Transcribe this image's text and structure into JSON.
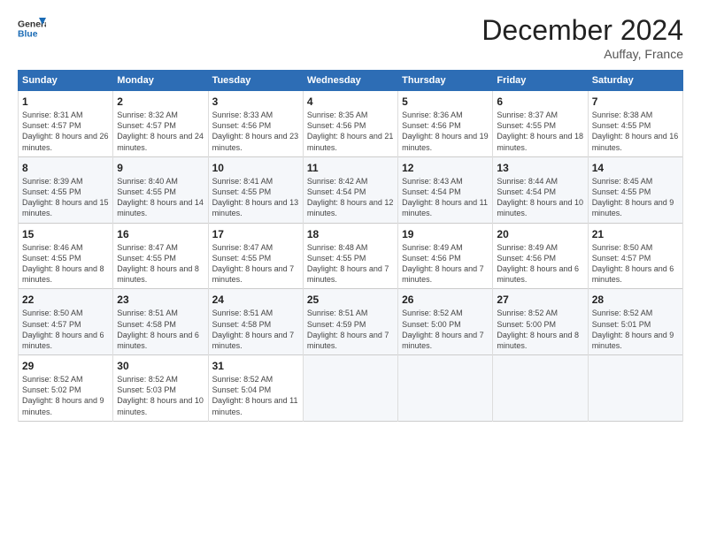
{
  "logo": {
    "line1": "General",
    "line2": "Blue"
  },
  "header": {
    "title": "December 2024",
    "location": "Auffay, France"
  },
  "days_of_week": [
    "Sunday",
    "Monday",
    "Tuesday",
    "Wednesday",
    "Thursday",
    "Friday",
    "Saturday"
  ],
  "weeks": [
    [
      {
        "day": "1",
        "rise": "Sunrise: 8:31 AM",
        "set": "Sunset: 4:57 PM",
        "daylight": "Daylight: 8 hours and 26 minutes."
      },
      {
        "day": "2",
        "rise": "Sunrise: 8:32 AM",
        "set": "Sunset: 4:57 PM",
        "daylight": "Daylight: 8 hours and 24 minutes."
      },
      {
        "day": "3",
        "rise": "Sunrise: 8:33 AM",
        "set": "Sunset: 4:56 PM",
        "daylight": "Daylight: 8 hours and 23 minutes."
      },
      {
        "day": "4",
        "rise": "Sunrise: 8:35 AM",
        "set": "Sunset: 4:56 PM",
        "daylight": "Daylight: 8 hours and 21 minutes."
      },
      {
        "day": "5",
        "rise": "Sunrise: 8:36 AM",
        "set": "Sunset: 4:56 PM",
        "daylight": "Daylight: 8 hours and 19 minutes."
      },
      {
        "day": "6",
        "rise": "Sunrise: 8:37 AM",
        "set": "Sunset: 4:55 PM",
        "daylight": "Daylight: 8 hours and 18 minutes."
      },
      {
        "day": "7",
        "rise": "Sunrise: 8:38 AM",
        "set": "Sunset: 4:55 PM",
        "daylight": "Daylight: 8 hours and 16 minutes."
      }
    ],
    [
      {
        "day": "8",
        "rise": "Sunrise: 8:39 AM",
        "set": "Sunset: 4:55 PM",
        "daylight": "Daylight: 8 hours and 15 minutes."
      },
      {
        "day": "9",
        "rise": "Sunrise: 8:40 AM",
        "set": "Sunset: 4:55 PM",
        "daylight": "Daylight: 8 hours and 14 minutes."
      },
      {
        "day": "10",
        "rise": "Sunrise: 8:41 AM",
        "set": "Sunset: 4:55 PM",
        "daylight": "Daylight: 8 hours and 13 minutes."
      },
      {
        "day": "11",
        "rise": "Sunrise: 8:42 AM",
        "set": "Sunset: 4:54 PM",
        "daylight": "Daylight: 8 hours and 12 minutes."
      },
      {
        "day": "12",
        "rise": "Sunrise: 8:43 AM",
        "set": "Sunset: 4:54 PM",
        "daylight": "Daylight: 8 hours and 11 minutes."
      },
      {
        "day": "13",
        "rise": "Sunrise: 8:44 AM",
        "set": "Sunset: 4:54 PM",
        "daylight": "Daylight: 8 hours and 10 minutes."
      },
      {
        "day": "14",
        "rise": "Sunrise: 8:45 AM",
        "set": "Sunset: 4:55 PM",
        "daylight": "Daylight: 8 hours and 9 minutes."
      }
    ],
    [
      {
        "day": "15",
        "rise": "Sunrise: 8:46 AM",
        "set": "Sunset: 4:55 PM",
        "daylight": "Daylight: 8 hours and 8 minutes."
      },
      {
        "day": "16",
        "rise": "Sunrise: 8:47 AM",
        "set": "Sunset: 4:55 PM",
        "daylight": "Daylight: 8 hours and 8 minutes."
      },
      {
        "day": "17",
        "rise": "Sunrise: 8:47 AM",
        "set": "Sunset: 4:55 PM",
        "daylight": "Daylight: 8 hours and 7 minutes."
      },
      {
        "day": "18",
        "rise": "Sunrise: 8:48 AM",
        "set": "Sunset: 4:55 PM",
        "daylight": "Daylight: 8 hours and 7 minutes."
      },
      {
        "day": "19",
        "rise": "Sunrise: 8:49 AM",
        "set": "Sunset: 4:56 PM",
        "daylight": "Daylight: 8 hours and 7 minutes."
      },
      {
        "day": "20",
        "rise": "Sunrise: 8:49 AM",
        "set": "Sunset: 4:56 PM",
        "daylight": "Daylight: 8 hours and 6 minutes."
      },
      {
        "day": "21",
        "rise": "Sunrise: 8:50 AM",
        "set": "Sunset: 4:57 PM",
        "daylight": "Daylight: 8 hours and 6 minutes."
      }
    ],
    [
      {
        "day": "22",
        "rise": "Sunrise: 8:50 AM",
        "set": "Sunset: 4:57 PM",
        "daylight": "Daylight: 8 hours and 6 minutes."
      },
      {
        "day": "23",
        "rise": "Sunrise: 8:51 AM",
        "set": "Sunset: 4:58 PM",
        "daylight": "Daylight: 8 hours and 6 minutes."
      },
      {
        "day": "24",
        "rise": "Sunrise: 8:51 AM",
        "set": "Sunset: 4:58 PM",
        "daylight": "Daylight: 8 hours and 7 minutes."
      },
      {
        "day": "25",
        "rise": "Sunrise: 8:51 AM",
        "set": "Sunset: 4:59 PM",
        "daylight": "Daylight: 8 hours and 7 minutes."
      },
      {
        "day": "26",
        "rise": "Sunrise: 8:52 AM",
        "set": "Sunset: 5:00 PM",
        "daylight": "Daylight: 8 hours and 7 minutes."
      },
      {
        "day": "27",
        "rise": "Sunrise: 8:52 AM",
        "set": "Sunset: 5:00 PM",
        "daylight": "Daylight: 8 hours and 8 minutes."
      },
      {
        "day": "28",
        "rise": "Sunrise: 8:52 AM",
        "set": "Sunset: 5:01 PM",
        "daylight": "Daylight: 8 hours and 9 minutes."
      }
    ],
    [
      {
        "day": "29",
        "rise": "Sunrise: 8:52 AM",
        "set": "Sunset: 5:02 PM",
        "daylight": "Daylight: 8 hours and 9 minutes."
      },
      {
        "day": "30",
        "rise": "Sunrise: 8:52 AM",
        "set": "Sunset: 5:03 PM",
        "daylight": "Daylight: 8 hours and 10 minutes."
      },
      {
        "day": "31",
        "rise": "Sunrise: 8:52 AM",
        "set": "Sunset: 5:04 PM",
        "daylight": "Daylight: 8 hours and 11 minutes."
      },
      null,
      null,
      null,
      null
    ]
  ]
}
